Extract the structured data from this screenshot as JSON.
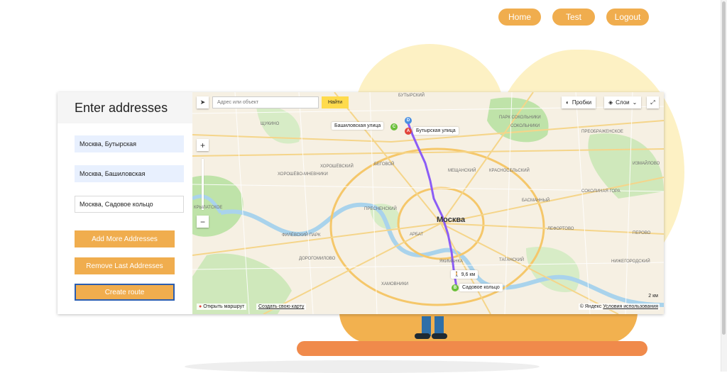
{
  "nav": {
    "home": "Home",
    "test": "Test",
    "logout": "Logout"
  },
  "panel": {
    "title": "Enter addresses",
    "addresses": [
      "Москва, Бутырская",
      "Москва, Башиловская",
      "Москва, Садовое кольцо"
    ],
    "add_label": "Add More Addresses",
    "remove_label": "Remove Last Addresses",
    "create_label": "Create route"
  },
  "map": {
    "search_placeholder": "Адрес или объект",
    "find_label": "Найти",
    "traffic_label": "Пробки",
    "layers_label": "Слои",
    "city_label": "Москва",
    "tag_bashilovskaya": "Башиловская улица",
    "tag_butyrskaya": "Бутырская улица",
    "tag_distance": "9,6 км",
    "tag_sadovoe": "Садовое кольцо",
    "pin_a": "A",
    "pin_b": "B",
    "pin_c": "C",
    "pin_d": "D",
    "open_route": "Открыть маршрут",
    "create_map": "Создать свою карту",
    "scale": "2 км",
    "copyright_prefix": "© Яндекс",
    "terms": "Условия использования",
    "districts": [
      "БУТЫРСКИЙ",
      "ПАРК СОКОЛЬНИКИ",
      "СОКОЛЬНИКИ",
      "ХОРОШЁВО-МНЕВНИКИ",
      "ХОРОШЁВСКИЙ",
      "БЕГОВОЙ",
      "МЕЩАНСКИЙ",
      "КРАСНОСЕЛЬСКИЙ",
      "БАСМАННЫЙ",
      "ПРЕСНЕНСКИЙ",
      "АРБАТ",
      "ФИЛЁВСКИЙ ПАРК",
      "ДОРОГОМИЛОВО",
      "ТАГАНСКИЙ",
      "ХАМОВНИКИ",
      "ЛЕФОРТОВО",
      "ИЗМАЙЛОВО",
      "ПРЕОБРАЖЕНСКОЕ",
      "СОКОЛИНАЯ ГОРА",
      "ПЕРОВО",
      "НИЖЕГОРОДСКИЙ",
      "ЯКИМАНКА",
      "ЩУКИНО",
      "КРЫЛАТСКОЕ"
    ]
  },
  "colors": {
    "accent": "#f0ad4e",
    "route": "#8b5cf6",
    "water": "#a9d3ec",
    "park": "#bfe3a9"
  }
}
